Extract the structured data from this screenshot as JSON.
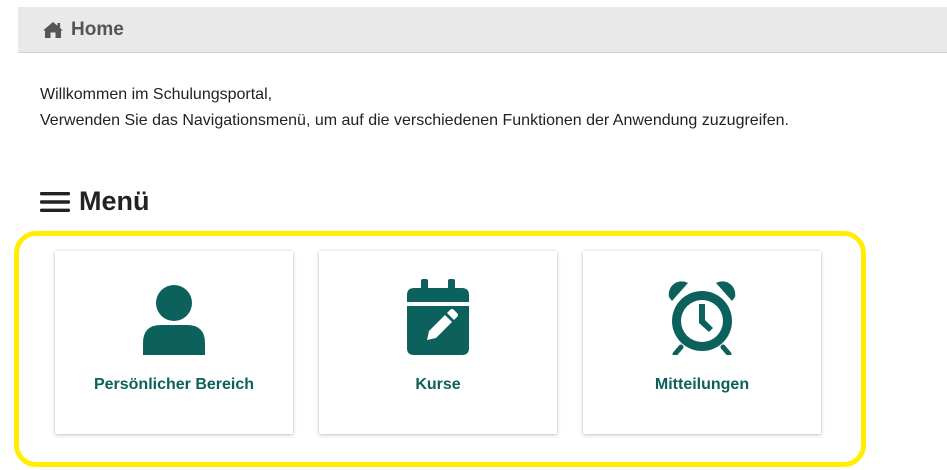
{
  "breadcrumb": {
    "home_label": "Home",
    "home_icon": "home-icon"
  },
  "welcome": {
    "line1": "Willkommen im Schulungsportal,",
    "line2": "Verwenden Sie das Navigationsmenü, um auf die verschiedenen Funktionen der Anwendung zuzugreifen."
  },
  "menu": {
    "title": "Menü",
    "title_icon": "hamburger-icon",
    "cards": [
      {
        "label": "Persönlicher Bereich",
        "icon": "user-icon"
      },
      {
        "label": "Kurse",
        "icon": "calendar-edit-icon"
      },
      {
        "label": "Mitteilungen",
        "icon": "alarm-clock-icon"
      }
    ]
  },
  "colors": {
    "accent": "#0d615c",
    "highlight": "#ffee00",
    "breadcrumb_bg": "#e9e9e9"
  }
}
